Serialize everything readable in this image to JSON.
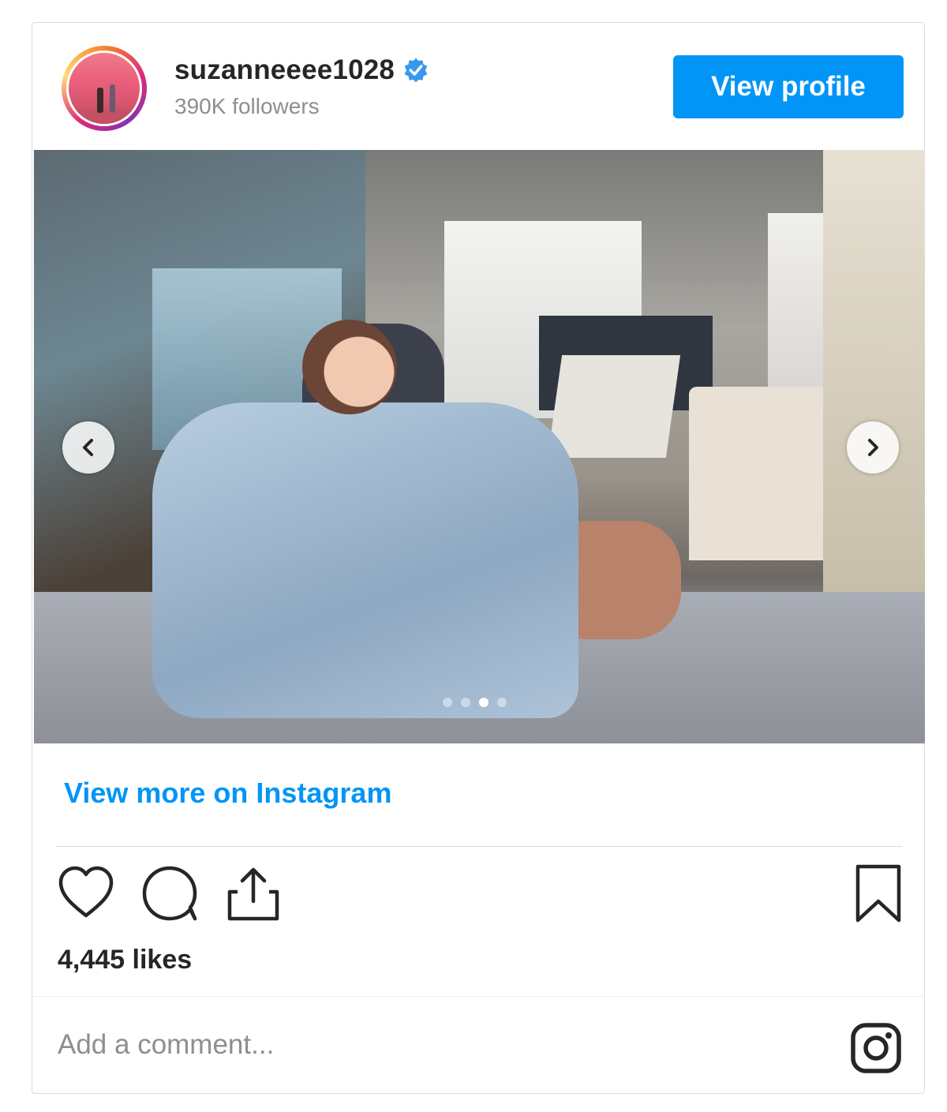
{
  "header": {
    "username": "suzanneeee1028",
    "followers": "390K followers",
    "view_profile_label": "View profile",
    "verified_icon": "verified-badge-icon",
    "accent_color": "#0095f6"
  },
  "media": {
    "carousel_slides": 4,
    "active_slide": 2,
    "prev_icon": "chevron-left-icon",
    "next_icon": "chevron-right-icon"
  },
  "view_more_label": "View more on Instagram",
  "actions": {
    "like_icon": "heart-icon",
    "comment_icon": "comment-icon",
    "share_icon": "share-icon",
    "save_icon": "bookmark-icon"
  },
  "likes": "4,445 likes",
  "comment": {
    "placeholder": "Add a comment..."
  },
  "footer_icon": "instagram-icon"
}
